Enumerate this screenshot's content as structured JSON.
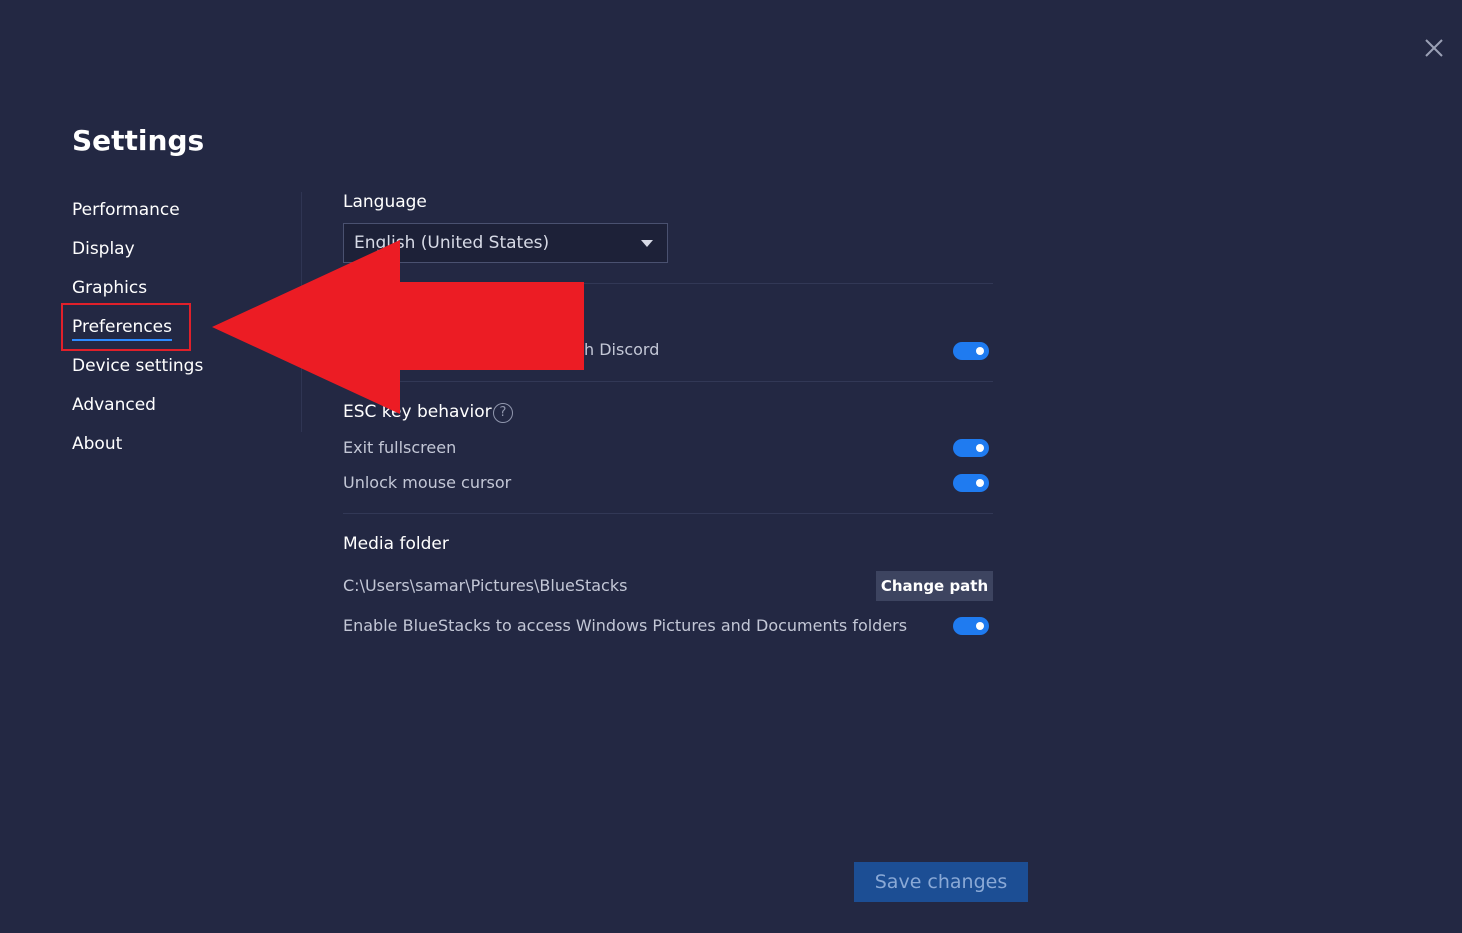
{
  "header": {
    "title": "Settings",
    "close_icon": "close-icon"
  },
  "sidebar": {
    "items": [
      {
        "label": "Performance"
      },
      {
        "label": "Display"
      },
      {
        "label": "Graphics"
      },
      {
        "label": "Preferences",
        "active": true
      },
      {
        "label": "Device settings"
      },
      {
        "label": "Advanced"
      },
      {
        "label": "About"
      }
    ]
  },
  "preferences": {
    "language": {
      "label": "Language",
      "selected": "English (United States)"
    },
    "discord": {
      "visible_text": "h Discord",
      "enabled": true
    },
    "esc_key": {
      "label": "ESC key behavior",
      "help_icon": "?",
      "options": [
        {
          "label": "Exit fullscreen",
          "enabled": true
        },
        {
          "label": "Unlock mouse cursor",
          "enabled": true
        }
      ]
    },
    "media_folder": {
      "label": "Media folder",
      "path": "C:\\Users\\samar\\Pictures\\BlueStacks",
      "change_path_label": "Change path",
      "access_label": "Enable BlueStacks to access Windows Pictures and Documents folders",
      "access_enabled": true
    }
  },
  "footer": {
    "save_label": "Save changes"
  },
  "colors": {
    "background": "#232843",
    "accent": "#1f7bf0",
    "annotation": "#ec1c24"
  }
}
